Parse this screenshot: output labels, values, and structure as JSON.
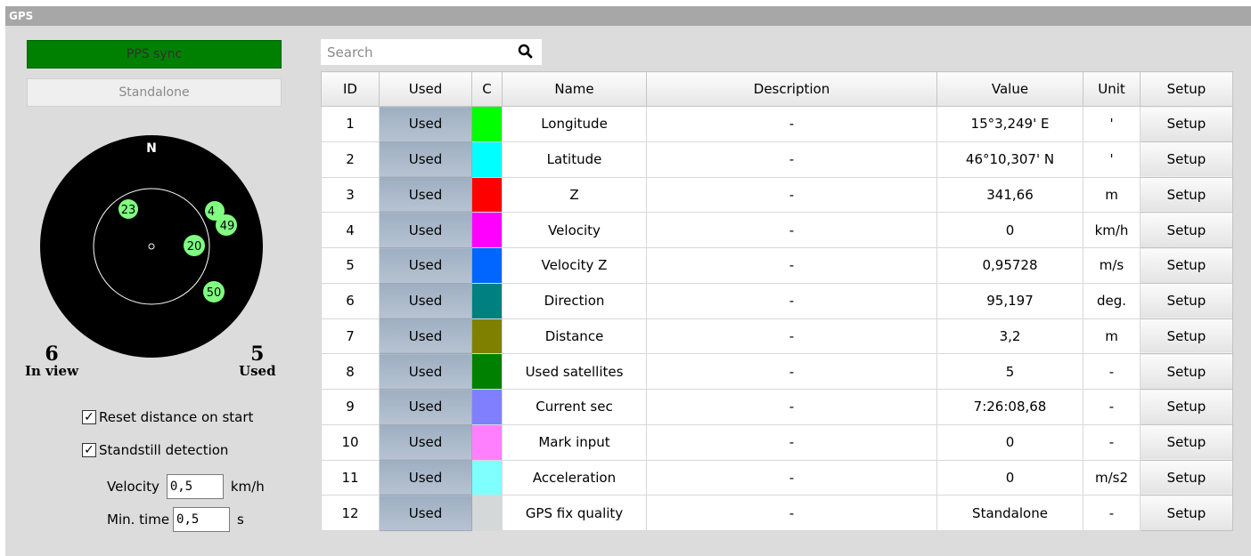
{
  "window": {
    "title": "GPS"
  },
  "status": {
    "pps_label": "PPS sync",
    "fix_label": "Standalone"
  },
  "sky_plot": {
    "north_label": "N",
    "satellites": [
      "23",
      "4",
      "49",
      "20",
      "50"
    ]
  },
  "counts": {
    "in_view_value": "6",
    "in_view_label": "In view",
    "used_value": "5",
    "used_label": "Used"
  },
  "options": {
    "reset_distance": {
      "label": "Reset distance on start",
      "checked": true
    },
    "standstill": {
      "label": "Standstill detection",
      "checked": true
    },
    "velocity": {
      "label": "Velocity",
      "value": "0,5",
      "unit": "km/h"
    },
    "min_time": {
      "label": "Min. time",
      "value": "0,5",
      "unit": "s"
    }
  },
  "search": {
    "placeholder": "Search",
    "icon": "magnifier-icon"
  },
  "table": {
    "headers": [
      "ID",
      "Used",
      "C",
      "Name",
      "Description",
      "Value",
      "Unit",
      "Setup"
    ],
    "rows": [
      {
        "id": "1",
        "used": "Used",
        "color": "#00ff00",
        "name": "Longitude",
        "description": "-",
        "value": "15°3,249' E",
        "unit": "'",
        "setup": "Setup"
      },
      {
        "id": "2",
        "used": "Used",
        "color": "#00ffff",
        "name": "Latitude",
        "description": "-",
        "value": "46°10,307' N",
        "unit": "'",
        "setup": "Setup"
      },
      {
        "id": "3",
        "used": "Used",
        "color": "#ff0000",
        "name": "Z",
        "description": "-",
        "value": "341,66",
        "unit": "m",
        "setup": "Setup"
      },
      {
        "id": "4",
        "used": "Used",
        "color": "#ff00ff",
        "name": "Velocity",
        "description": "-",
        "value": "0",
        "unit": "km/h",
        "setup": "Setup"
      },
      {
        "id": "5",
        "used": "Used",
        "color": "#0066ff",
        "name": "Velocity Z",
        "description": "-",
        "value": "0,95728",
        "unit": "m/s",
        "setup": "Setup"
      },
      {
        "id": "6",
        "used": "Used",
        "color": "#008080",
        "name": "Direction",
        "description": "-",
        "value": "95,197",
        "unit": "deg.",
        "setup": "Setup"
      },
      {
        "id": "7",
        "used": "Used",
        "color": "#808000",
        "name": "Distance",
        "description": "-",
        "value": "3,2",
        "unit": "m",
        "setup": "Setup"
      },
      {
        "id": "8",
        "used": "Used",
        "color": "#008000",
        "name": "Used satellites",
        "description": "-",
        "value": "5",
        "unit": "-",
        "setup": "Setup"
      },
      {
        "id": "9",
        "used": "Used",
        "color": "#8080ff",
        "name": "Current sec",
        "description": "-",
        "value": "7:26:08,68",
        "unit": "-",
        "setup": "Setup"
      },
      {
        "id": "10",
        "used": "Used",
        "color": "#ff80ff",
        "name": "Mark input",
        "description": "-",
        "value": "0",
        "unit": "-",
        "setup": "Setup"
      },
      {
        "id": "11",
        "used": "Used",
        "color": "#80ffff",
        "name": "Acceleration",
        "description": "-",
        "value": "0",
        "unit": "m/s2",
        "setup": "Setup"
      },
      {
        "id": "12",
        "used": "Used",
        "color": "#d4d8d8",
        "name": "GPS fix quality",
        "description": "-",
        "value": "Standalone",
        "unit": "-",
        "setup": "Setup"
      }
    ]
  }
}
